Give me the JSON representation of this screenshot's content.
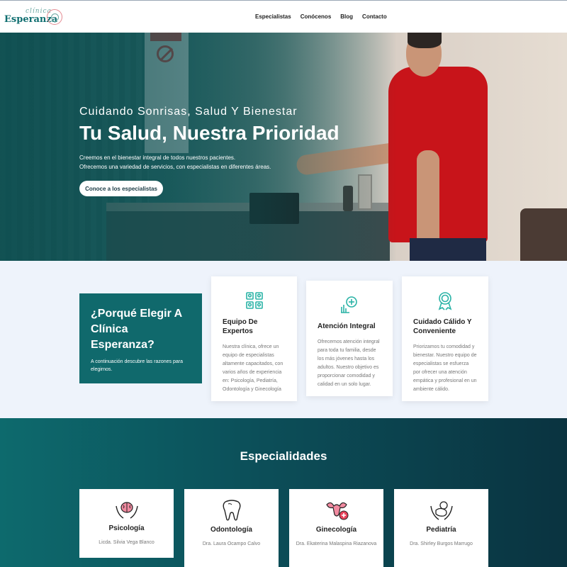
{
  "nav": {
    "logo_top": "clínica",
    "logo_main": "Esperanza",
    "links": [
      "Especialistas",
      "Conócenos",
      "Blog",
      "Contacto"
    ]
  },
  "hero": {
    "subtitle": "Cuidando Sonrisas, Salud Y Bienestar",
    "title": "Tu Salud, Nuestra Prioridad",
    "desc_line1": "Creemos en el bienestar integral de todos nuestros pacientes.",
    "desc_line2": "Ofrecemos una variedad de servicios, con especialistas en diferentes áreas.",
    "button": "Conoce a los especialistas"
  },
  "why": {
    "title": "¿Porqué Elegir A Clínica Esperanza?",
    "desc": "A continuación descubre las razones para elegirnos."
  },
  "features": [
    {
      "icon": "team-puzzle-icon",
      "title": "Equipo De Expertos",
      "text": "Nuestra clínica, ofrece un equipo de especialistas altamente capacitados, con varios años de experiencia en: Psicología, Pediatría, Odontología y Ginecología"
    },
    {
      "icon": "integral-care-icon",
      "title": "Atención Integral",
      "text": "Ofrecemos atención integral para toda tu familia, desde los más jóvenes hasta los adultos. Nuestro objetivo es proporcionar comodidad y calidad en un solo lugar."
    },
    {
      "icon": "award-badge-icon",
      "title": "Cuidado Cálido Y Conveniente",
      "text": "Priorizamos tu comodidad y bienestar. Nuestro equipo de especialistas se esfuerza por ofrecer una atención empática y profesional en un ambiente cálido."
    }
  ],
  "specialties": {
    "title": "Especialidades",
    "items": [
      {
        "icon": "brain-hands-icon",
        "name": "Psicología",
        "doctor": "Licda. Silvia Vega Blanco"
      },
      {
        "icon": "tooth-icon",
        "name": "Odontología",
        "doctor": "Dra. Laura Ocampo Calvo"
      },
      {
        "icon": "uterus-icon",
        "name": "Ginecología",
        "doctor": "Dra. Ekaterina Malaspina Riazanova"
      },
      {
        "icon": "baby-hands-icon",
        "name": "Pediatría",
        "doctor": "Dra. Shirley Burgos Marrugo"
      }
    ]
  },
  "colors": {
    "accent": "#10696c",
    "text": "#222222",
    "muted": "#777777"
  }
}
